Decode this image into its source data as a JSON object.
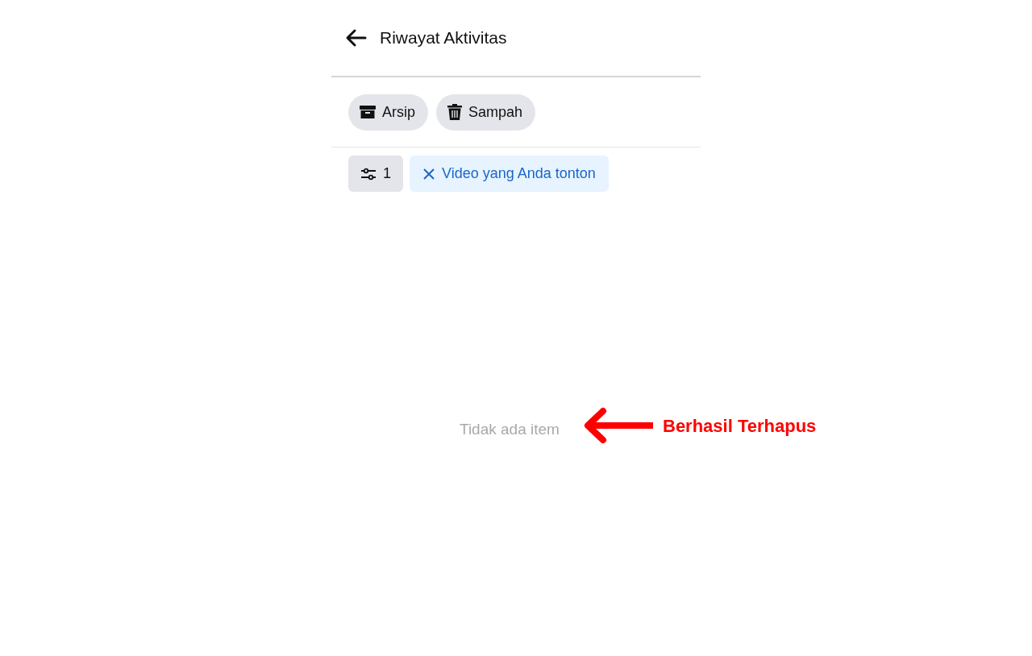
{
  "header": {
    "title": "Riwayat Aktivitas"
  },
  "chips": [
    {
      "label": "Arsip",
      "kind": "archive"
    },
    {
      "label": "Sampah",
      "kind": "trash"
    }
  ],
  "filter": {
    "count": "1",
    "active_filter": "Video yang Anda tonton"
  },
  "empty_text": "Tidak ada item",
  "annotation": {
    "text": "Berhasil Terhapus",
    "color": "#ff0000"
  }
}
